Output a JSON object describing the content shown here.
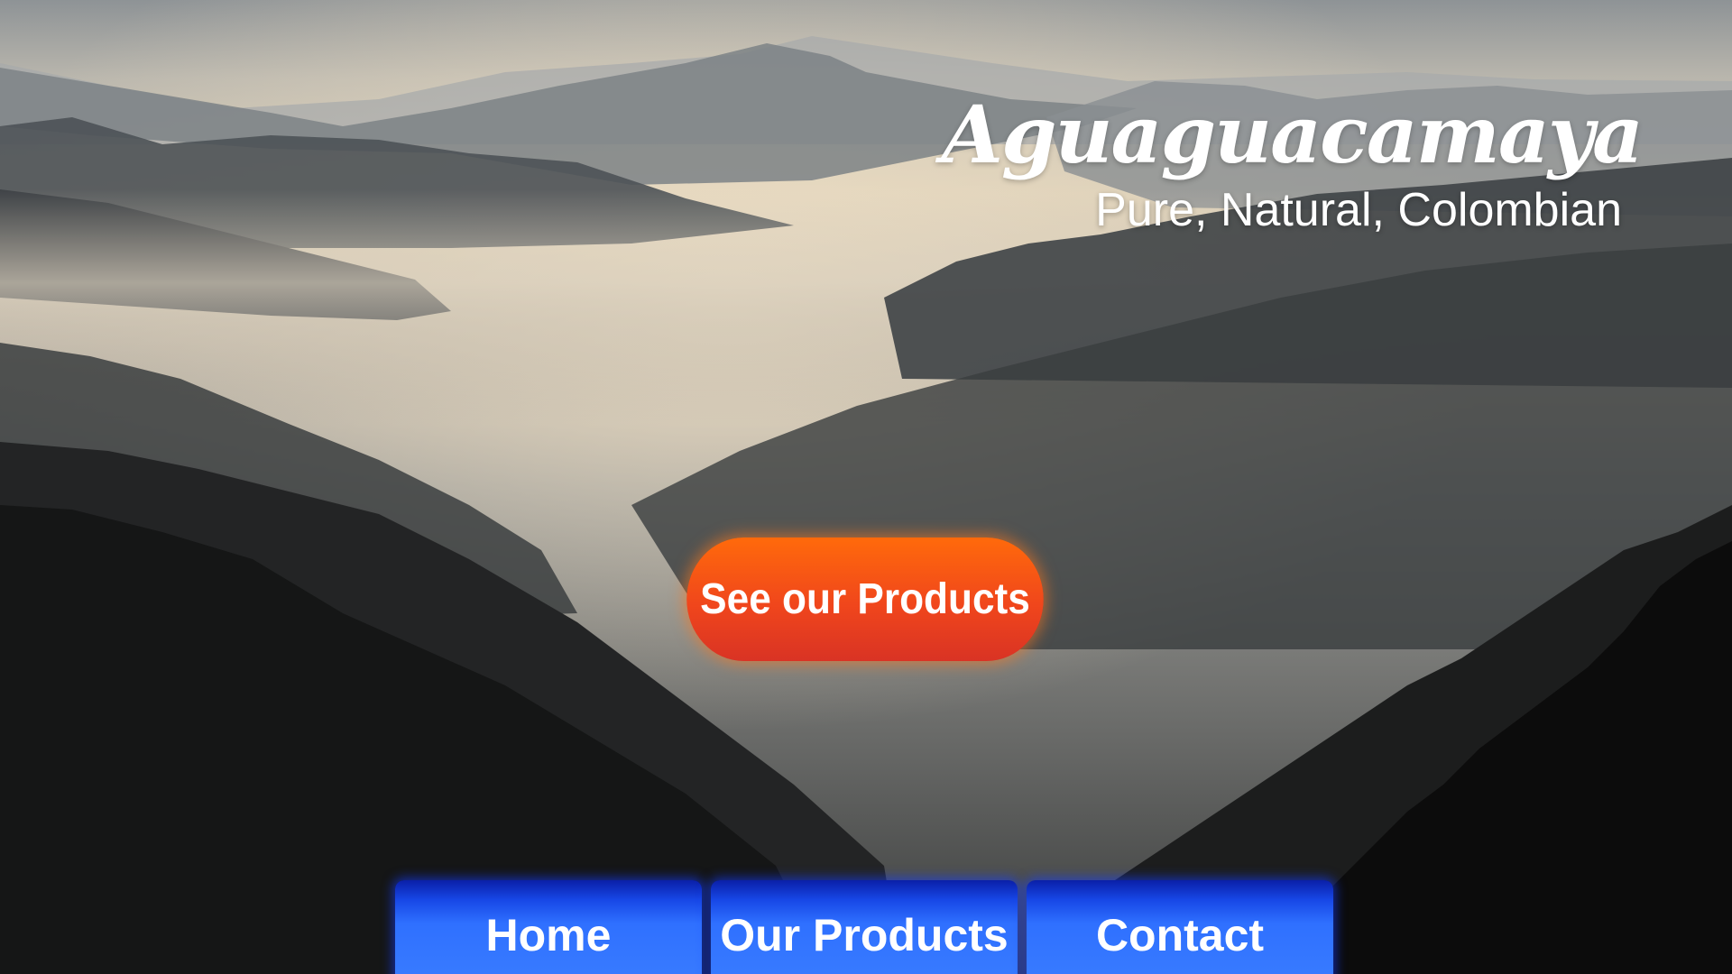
{
  "brand": {
    "name": "Aguaguacamaya",
    "tagline": "Pure, Natural, Colombian"
  },
  "cta": {
    "label": "See our Products"
  },
  "nav": {
    "items": [
      {
        "label": "Home"
      },
      {
        "label": "Our Products"
      },
      {
        "label": "Contact"
      }
    ]
  },
  "colors": {
    "cta_top": "#ff6a0b",
    "cta_bottom": "#d93324",
    "nav_top": "#0a1fa8",
    "nav_bottom": "#3a7dff",
    "text": "#ffffff"
  }
}
